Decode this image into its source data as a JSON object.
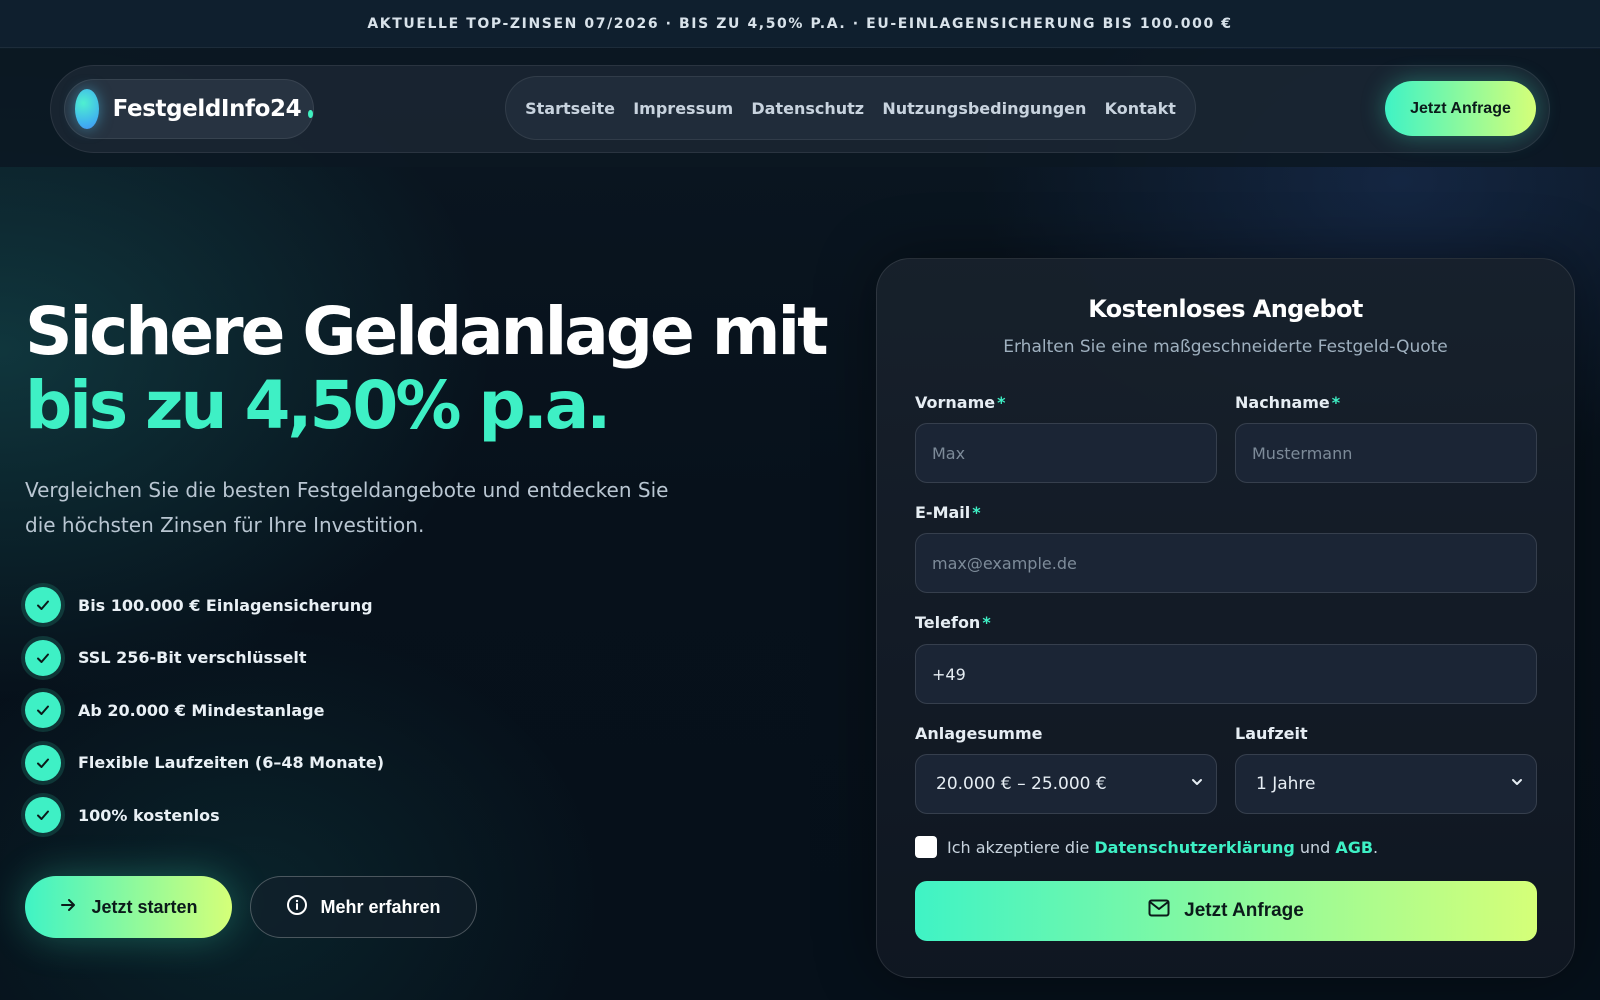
{
  "banner": {
    "text": "AKTUELLE TOP-ZINSEN 07/2026 · BIS ZU 4,50% P.A. · EU-EINLAGENSICHERUNG BIS 100.000 €"
  },
  "brand": {
    "name": "FestgeldInfo24"
  },
  "nav": {
    "links": [
      "Startseite",
      "Impressum",
      "Datenschutz",
      "Nutzungsbedingungen",
      "Kontakt"
    ],
    "cta": "Jetzt Anfrage"
  },
  "hero": {
    "title_line1": "Sichere Geldanlage mit",
    "title_line2": "bis zu 4,50% p.a.",
    "lead": "Vergleichen Sie die besten Festgeldangebote und entdecken Sie die höchsten Zinsen für Ihre Investition.",
    "features": [
      "Bis 100.000 € Einlagensicherung",
      "SSL 256-Bit verschlüsselt",
      "Ab 20.000 € Mindestanlage",
      "Flexible Laufzeiten (6–48 Monate)",
      "100% kostenlos"
    ],
    "primary_button": "Jetzt starten",
    "secondary_button": "Mehr erfahren"
  },
  "form": {
    "title": "Kostenloses Angebot",
    "subtitle": "Erhalten Sie eine maßgeschneiderte Festgeld-Quote",
    "required_mark": "*",
    "firstname": {
      "label": "Vorname",
      "placeholder": "Max"
    },
    "lastname": {
      "label": "Nachname",
      "placeholder": "Mustermann"
    },
    "email": {
      "label": "E-Mail",
      "placeholder": "max@example.de"
    },
    "phone": {
      "label": "Telefon",
      "value": "+49"
    },
    "amount": {
      "label": "Anlagesumme",
      "selected": "20.000 € – 25.000 €"
    },
    "term": {
      "label": "Laufzeit",
      "selected": "1 Jahre"
    },
    "consent": {
      "prefix": "Ich akzeptiere die",
      "privacy_link": "Datenschutzerklärung",
      "joiner": "und",
      "terms_link": "AGB",
      "suffix": "."
    },
    "submit": "Jetzt Anfrage"
  },
  "colors": {
    "accent": "#3ef0c5",
    "accent_end": "#d5ff78",
    "background": "#07121c"
  }
}
